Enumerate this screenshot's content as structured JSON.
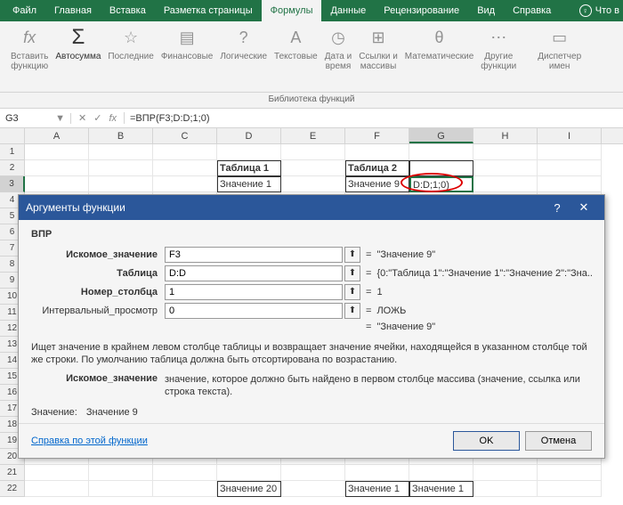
{
  "tabs": {
    "file": "Файл",
    "home": "Главная",
    "insert": "Вставка",
    "layout": "Разметка страницы",
    "formulas": "Формулы",
    "data": "Данные",
    "review": "Рецензирование",
    "view": "Вид",
    "help": "Справка",
    "tell": "Что в"
  },
  "ribbon": {
    "insert_fn_top": "Вставить",
    "insert_fn_bot": "функцию",
    "autosum": "Автосумма",
    "recent": "Последние",
    "financial": "Финансовые",
    "logical": "Логические",
    "text": "Текстовые",
    "datetime_top": "Дата и",
    "datetime_bot": "время",
    "lookup_top": "Ссылки и",
    "lookup_bot": "массивы",
    "math": "Математические",
    "more_top": "Другие",
    "more_bot": "функции",
    "namemgr_top": "Диспетчер",
    "namemgr_bot": "имен",
    "caption": "Библиотека функций"
  },
  "namebox": "G3",
  "formula": "=ВПР(F3;D:D;1;0)",
  "cols": [
    "A",
    "B",
    "C",
    "D",
    "E",
    "F",
    "G",
    "H",
    "I"
  ],
  "rows": [
    "1",
    "2",
    "3",
    "4",
    "5",
    "6",
    "7",
    "8",
    "9",
    "10",
    "11",
    "12",
    "13",
    "14",
    "15",
    "16",
    "17",
    "18",
    "19",
    "20",
    "21",
    "22"
  ],
  "sheet": {
    "d2": "Таблица 1",
    "d3": "Значение 1",
    "f2": "Таблица 2",
    "f3": "Значение 9",
    "g3": "D:D;1;0)",
    "d22": "Значение 20",
    "f22": "Значение 1",
    "g22": "Значение 1"
  },
  "fx_label": "fx",
  "sigma": "Σ",
  "dlg": {
    "title": "Аргументы функции",
    "fn": "ВПР",
    "arg1_lbl": "Искомое_значение",
    "arg1_val": "F3",
    "arg1_res": "\"Значение 9\"",
    "arg2_lbl": "Таблица",
    "arg2_val": "D:D",
    "arg2_res": "{0:\"Таблица 1\":\"Значение 1\":\"Значение 2\":\"Зна...",
    "arg3_lbl": "Номер_столбца",
    "arg3_val": "1",
    "arg3_res": "1",
    "arg4_lbl": "Интервальный_просмотр",
    "arg4_val": "0",
    "arg4_res": "ЛОЖЬ",
    "result": "\"Значение 9\"",
    "desc": "Ищет значение в крайнем левом столбце таблицы и возвращает значение ячейки, находящейся в указанном столбце той же строки. По умолчанию таблица должна быть отсортирована по возрастанию.",
    "argdesc_lbl": "Искомое_значение",
    "argdesc": "значение, которое должно быть найдено в первом столбце массива (значение, ссылка или строка текста).",
    "value_lbl": "Значение:",
    "value": "Значение 9",
    "help": "Справка по этой функции",
    "ok": "OK",
    "cancel": "Отмена",
    "eq": "="
  }
}
